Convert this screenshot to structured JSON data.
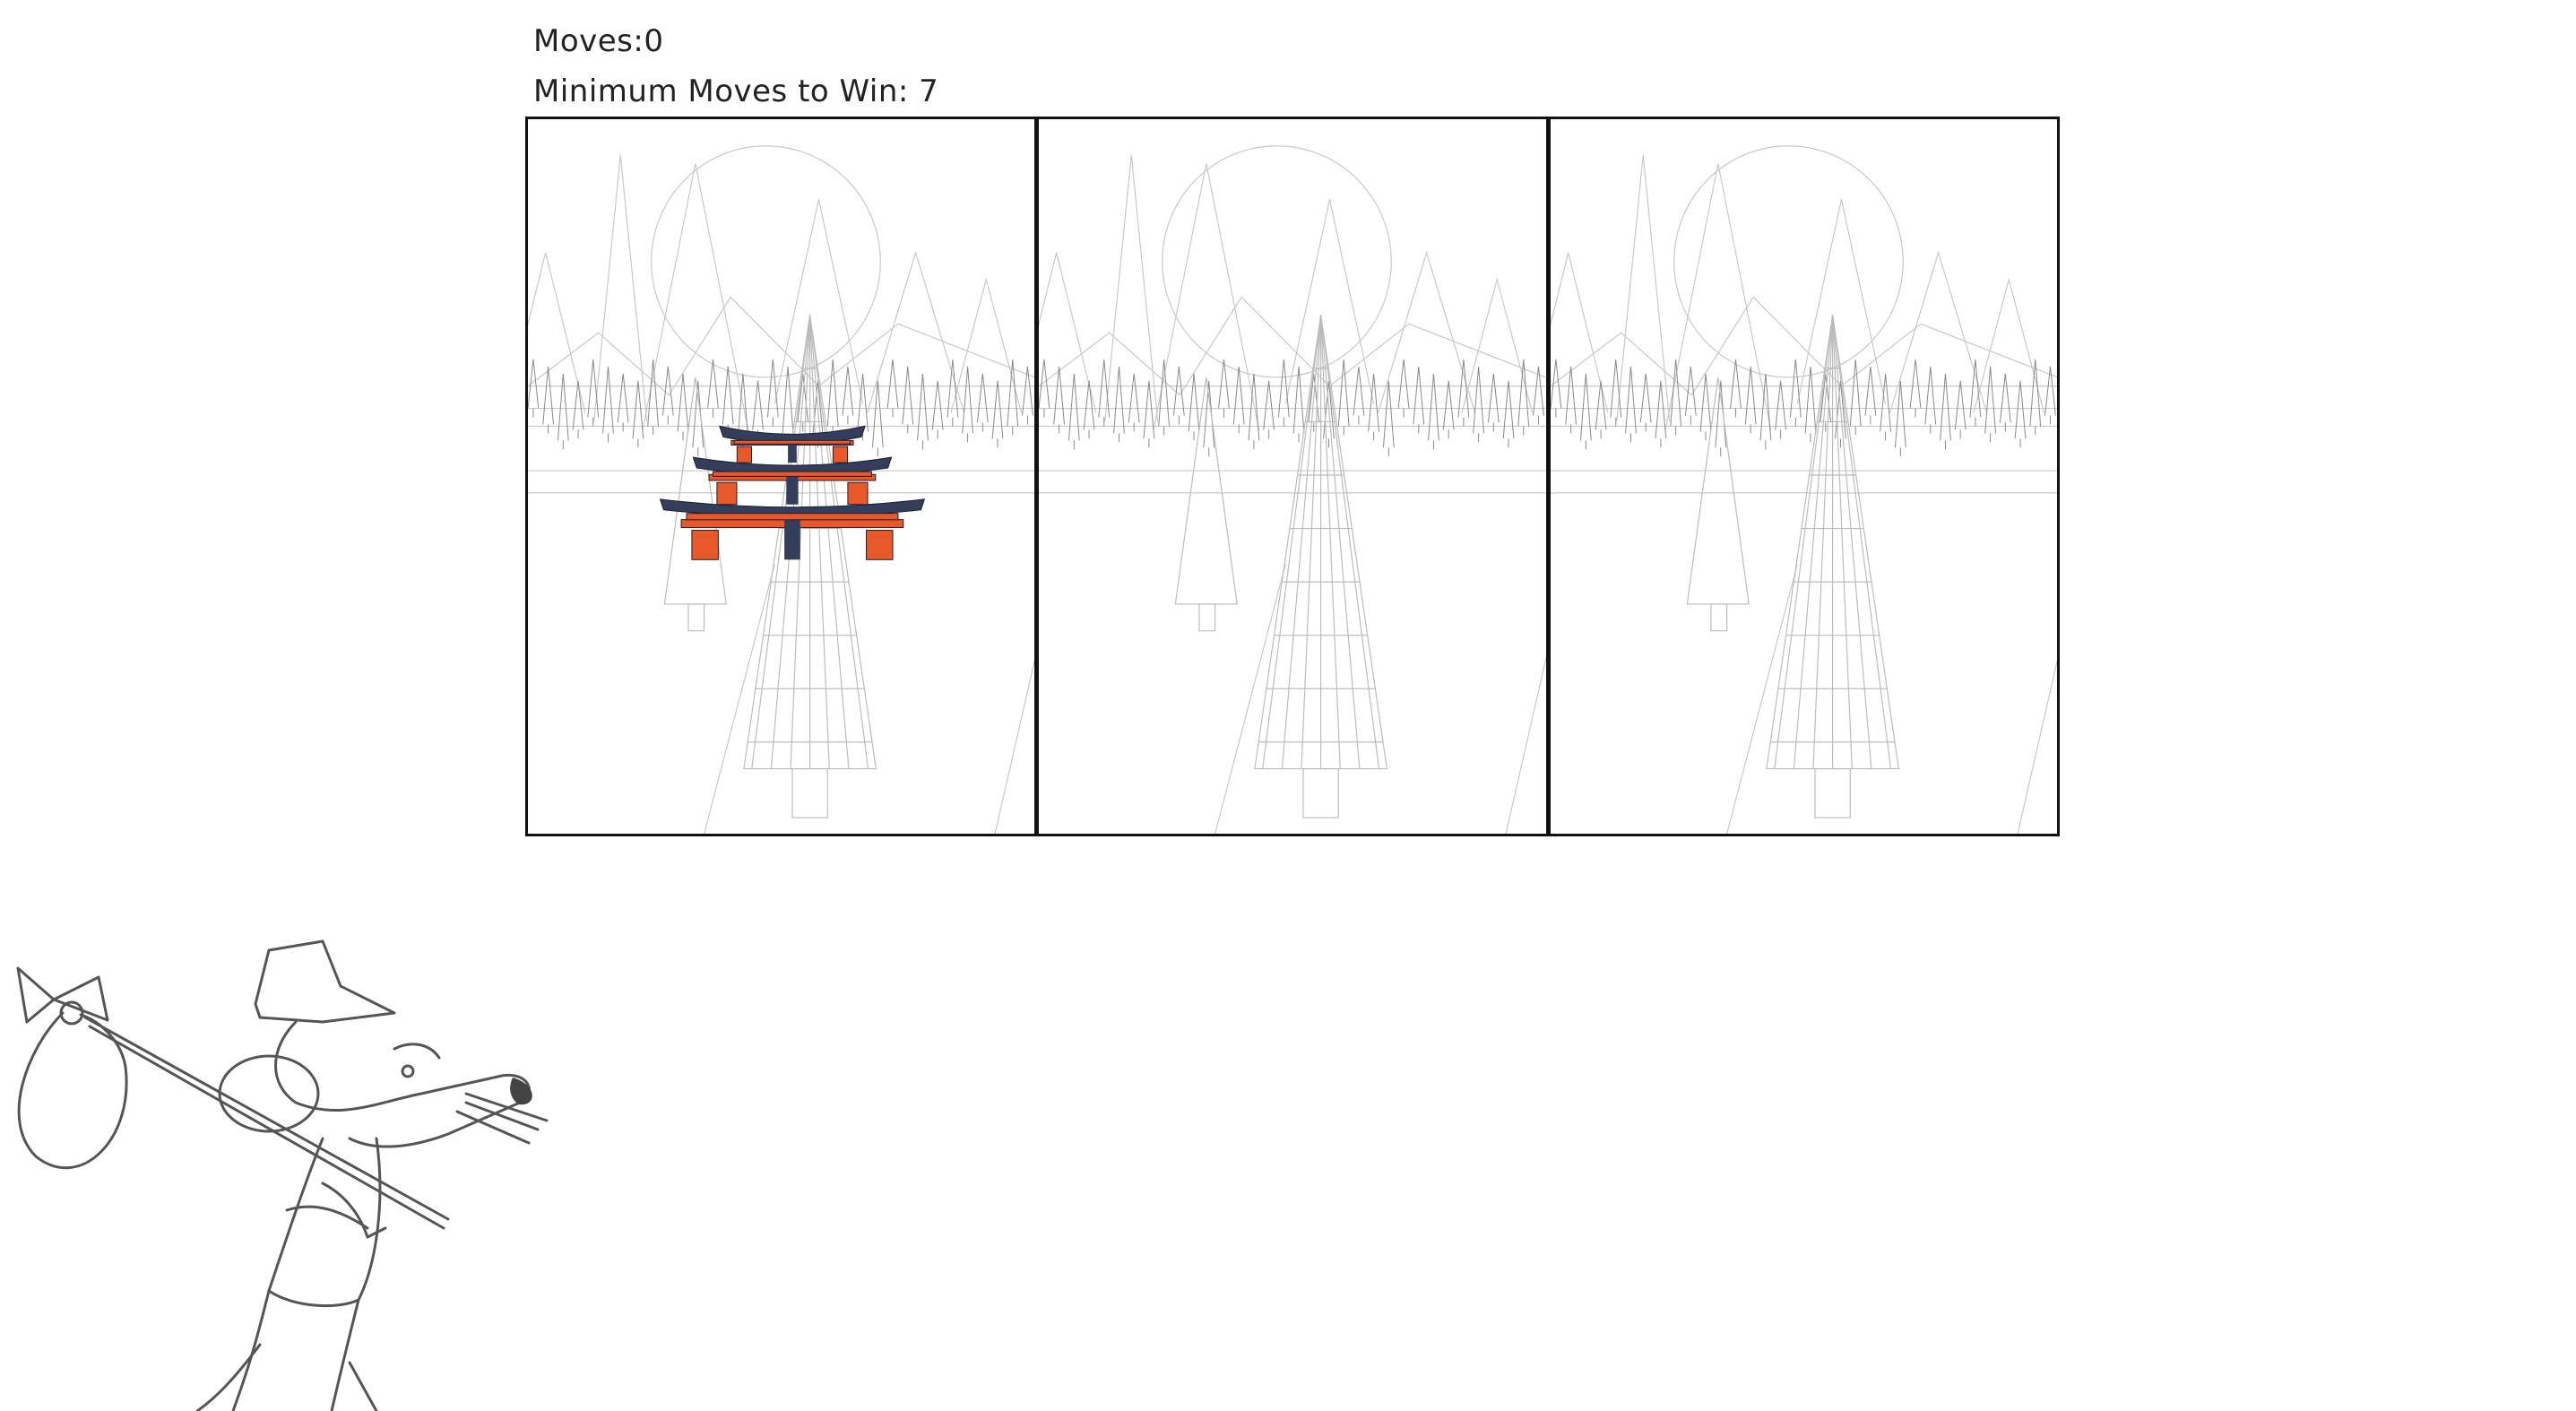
{
  "hud": {
    "moves_label": "Moves:",
    "moves_value": "0",
    "min_moves_text": "Minimum Moves to Win: 7"
  },
  "towers": [
    {
      "id": "left",
      "discs": [
        "large",
        "medium",
        "small"
      ]
    },
    {
      "id": "middle",
      "discs": []
    },
    {
      "id": "right",
      "discs": []
    }
  ],
  "colors": {
    "beam_navy": "#343d5a",
    "pillar_orange": "#e8582a",
    "sketch_line": "#c8c8c8",
    "border": "#111111"
  },
  "icons": {
    "disc": "torii-gate-icon",
    "background": "wireframe-forest-icon",
    "mascot": "traveling-mouse-icon"
  }
}
